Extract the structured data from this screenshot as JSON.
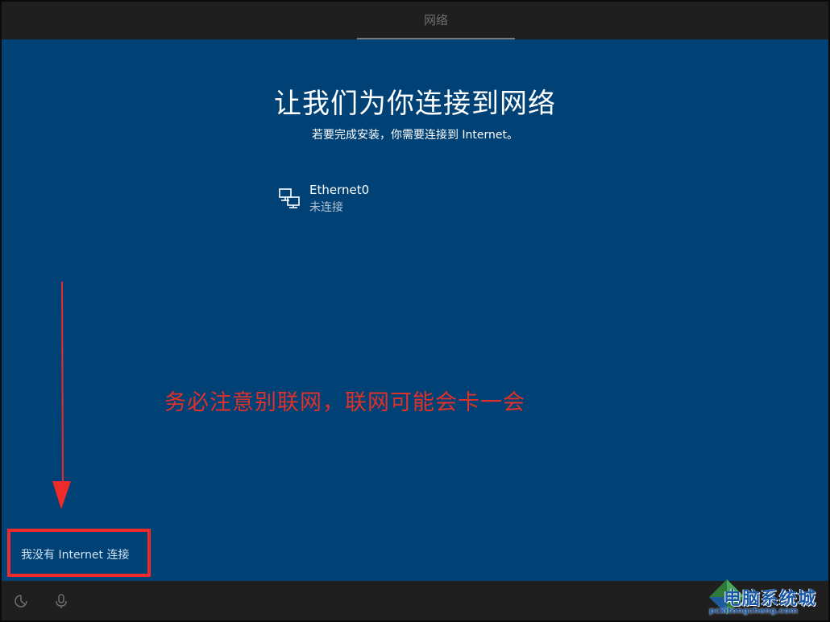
{
  "topbar": {
    "tab_label": "网络"
  },
  "main": {
    "title": "让我们为你连接到网络",
    "subtitle": "若要完成安装，你需要连接到 Internet。",
    "networks": [
      {
        "name": "Ethernet0",
        "status": "未连接",
        "icon": "ethernet-icon"
      }
    ],
    "no_internet_link": "我没有 Internet 连接"
  },
  "annotation": {
    "text": "务必注意别联网，联网可能会卡一会",
    "color": "#e0302a"
  },
  "bottombar": {
    "icons": [
      "accessibility-icon",
      "microphone-icon"
    ]
  },
  "watermark": {
    "text": "电脑系统城",
    "subtext": "pcxitongcheng.com"
  },
  "colors": {
    "background": "#004275",
    "bars": "#1f1f1f",
    "highlight_box": "#ee2a2a"
  }
}
